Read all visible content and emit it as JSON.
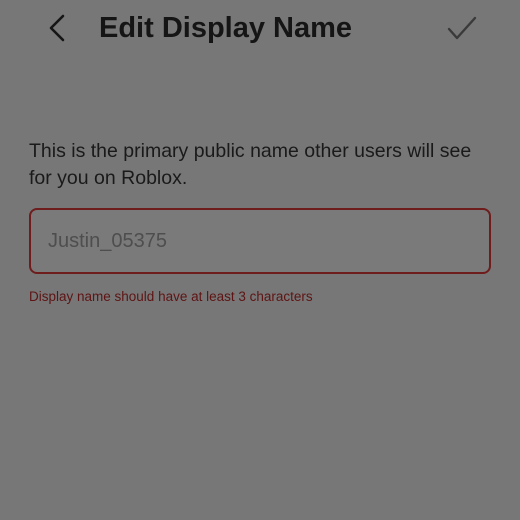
{
  "header": {
    "title": "Edit Display Name",
    "back_icon": "chevron-left-icon",
    "confirm_icon": "checkmark-icon"
  },
  "main": {
    "description": "This is the primary public name other users will see for you on Roblox.",
    "display_name_input": {
      "value": "Justin_05375",
      "placeholder": ""
    },
    "error_message": "Display name should have at least 3 characters"
  },
  "colors": {
    "background": "#777777",
    "title_text": "#151515",
    "error_border": "#6e1c1c",
    "error_text": "#5e1414"
  }
}
